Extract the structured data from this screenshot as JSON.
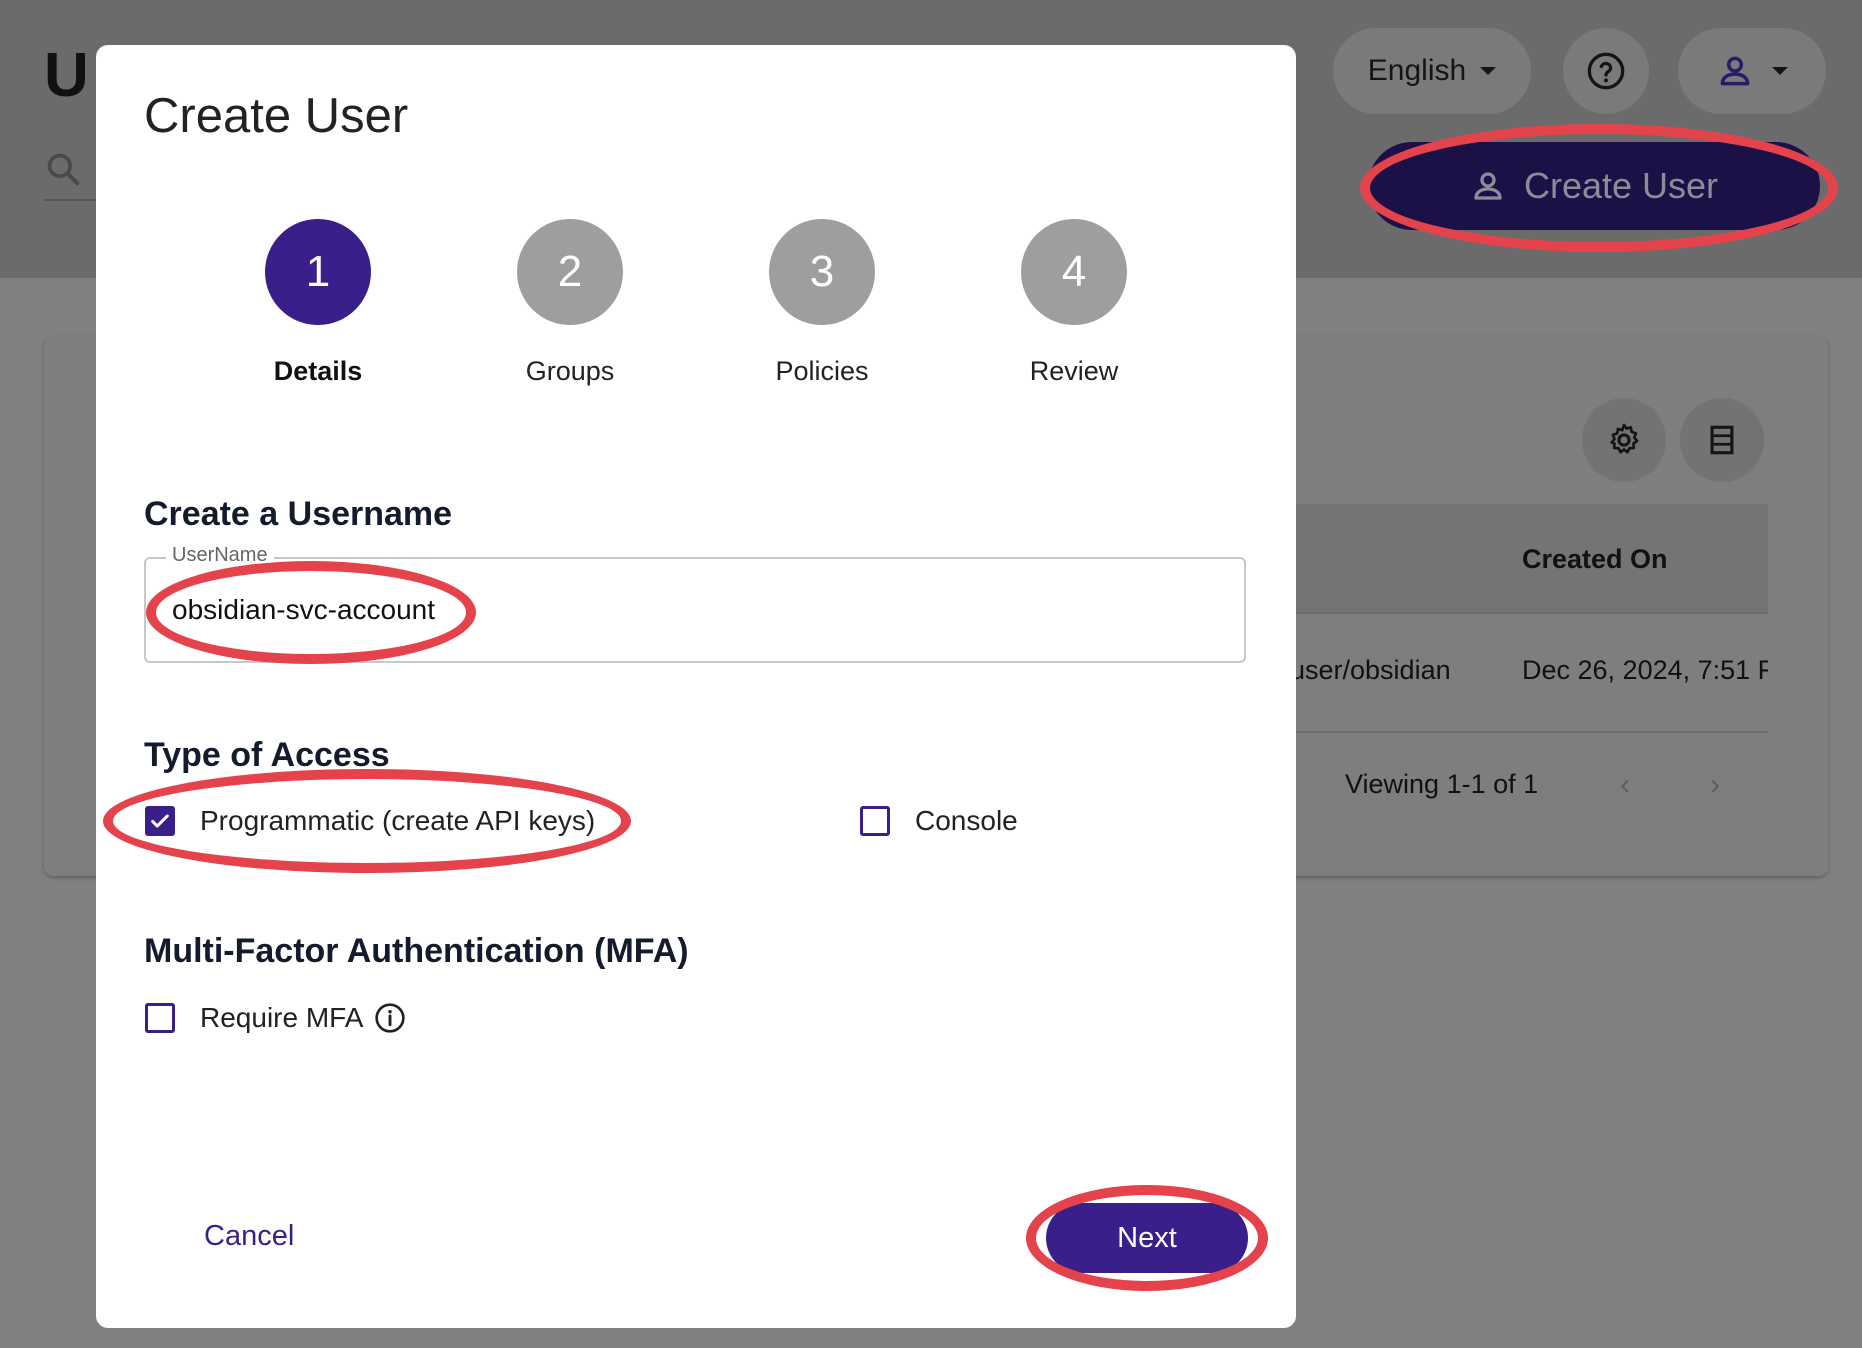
{
  "background": {
    "page_title_letter": "U",
    "language": "English",
    "create_user_label": "Create User",
    "table": {
      "header_created_on": "Created On",
      "row_user_fragment": "user/obsidian",
      "row_created_on": "Dec 26, 2024, 7:51 F",
      "pagination": "Viewing 1-1 of 1"
    }
  },
  "modal": {
    "title": "Create User",
    "steps": [
      {
        "number": "1",
        "label": "Details",
        "active": true
      },
      {
        "number": "2",
        "label": "Groups",
        "active": false
      },
      {
        "number": "3",
        "label": "Policies",
        "active": false
      },
      {
        "number": "4",
        "label": "Review",
        "active": false
      }
    ],
    "username_section": "Create a Username",
    "username_field_label": "UserName",
    "username_value": "obsidian-svc-account",
    "access_section": "Type of Access",
    "access_options": [
      {
        "label": "Programmatic (create API keys)",
        "checked": true
      },
      {
        "label": "Console",
        "checked": false
      }
    ],
    "mfa_section": "Multi-Factor Authentication (MFA)",
    "mfa_option": {
      "label": "Require MFA",
      "checked": false
    },
    "cancel_label": "Cancel",
    "next_label": "Next"
  },
  "colors": {
    "primary": "#3a1f8a",
    "highlight": "#e4434c",
    "step_inactive": "#9e9e9e"
  },
  "icons": [
    "search-icon",
    "caret-down-icon",
    "help-icon",
    "user-icon",
    "gear-icon",
    "columns-icon",
    "chevron-left-icon",
    "chevron-right-icon",
    "check-icon",
    "info-icon"
  ]
}
